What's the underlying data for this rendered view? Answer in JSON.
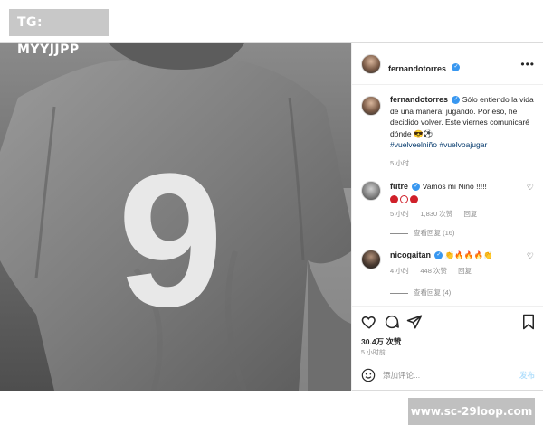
{
  "watermark_top": "TG: MYYJJPP",
  "watermark_bottom": "www.sc-29loop.com",
  "photo": {
    "jersey_number": "9"
  },
  "post": {
    "username": "fernandotorres",
    "caption": {
      "username": "fernandotorres",
      "text": "Sólo entiendo la vida de una manera: jugando. Por eso, he decidido volver. Este viernes comunicaré dónde",
      "emojis": "😎⚽",
      "hashtags": "#vuelveelniño #vuelvoajugar",
      "time": "5 小时"
    },
    "comments": [
      {
        "username": "futre",
        "text": "Vamos mi Niño !!!!!",
        "time": "5 小时",
        "likes": "1,830 次赞",
        "reply": "回复",
        "view_replies": "查看回复 (16)",
        "emoji_colors": [
          "#d0202a",
          "#ffffff",
          "#d0202a"
        ]
      },
      {
        "username": "nicogaitan",
        "text": "",
        "emojis": "👏🔥🔥🔥👏",
        "time": "4 小时",
        "likes": "448 次赞",
        "reply": "回复",
        "view_replies": "查看回复 (4)"
      }
    ],
    "likes_count": "30.4万 次赞",
    "post_time": "5 小时前",
    "comment_placeholder": "添加评论...",
    "post_button": "发布"
  },
  "icons": {
    "more": "more-horizontal-icon",
    "heart": "heart-icon",
    "comment": "comment-icon",
    "share": "share-icon",
    "save": "bookmark-icon",
    "emoji": "smile-icon",
    "verified": "verified-badge-icon"
  },
  "colors": {
    "verified": "#3897f0",
    "hashtag": "#00376b",
    "muted": "#8e8e8e",
    "post_button": "#b2dffc"
  }
}
